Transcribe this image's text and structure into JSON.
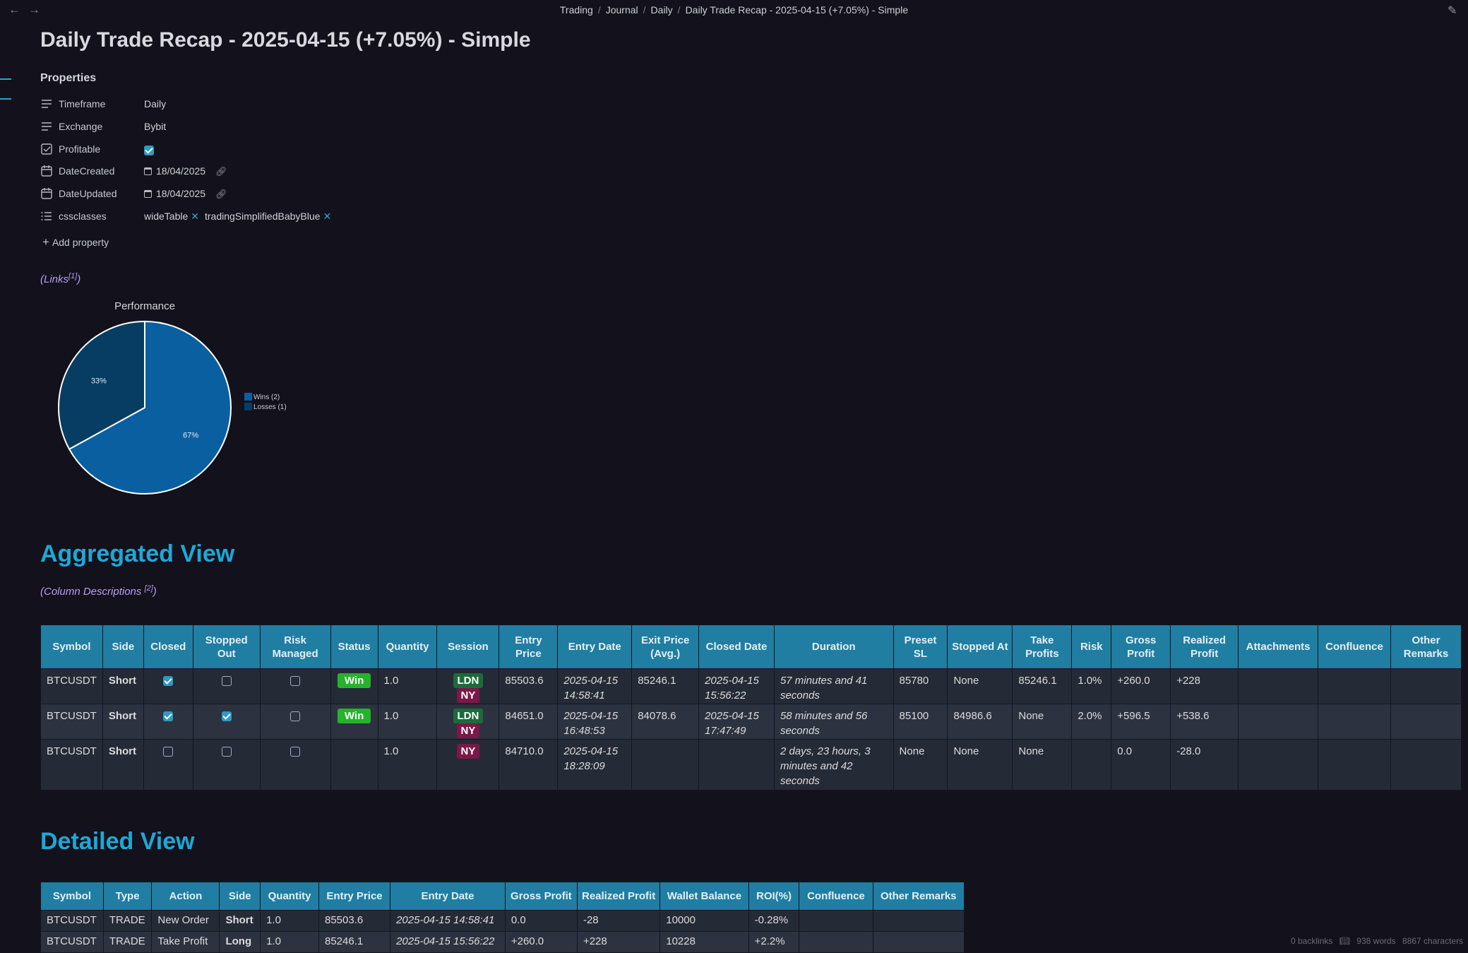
{
  "breadcrumb": [
    "Trading",
    "Journal",
    "Daily",
    "Daily Trade Recap - 2025-04-15 (+7.05%) - Simple"
  ],
  "title": "Daily Trade Recap - 2025-04-15 (+7.05%) - Simple",
  "properties": {
    "heading": "Properties",
    "timeframe": {
      "key": "Timeframe",
      "value": "Daily"
    },
    "exchange": {
      "key": "Exchange",
      "value": "Bybit"
    },
    "profitable": {
      "key": "Profitable",
      "checked": true
    },
    "date_created": {
      "key": "DateCreated",
      "value": "18/04/2025"
    },
    "date_updated": {
      "key": "DateUpdated",
      "value": "18/04/2025"
    },
    "cssclasses": {
      "key": "cssclasses",
      "tags": [
        "wideTable",
        "tradingSimplifiedBabyBlue"
      ]
    },
    "add_label": "Add property"
  },
  "links": {
    "label": "Links",
    "ref": "[1]"
  },
  "chart_data": {
    "type": "pie",
    "title": "Performance",
    "slices": [
      {
        "label": "Wins (2)",
        "value": 67,
        "display": "67%",
        "color": "#0a5fa0"
      },
      {
        "label": "Losses (1)",
        "value": 33,
        "display": "33%",
        "color": "#083d63"
      }
    ]
  },
  "aggregated": {
    "heading": "Aggregated View",
    "col_desc": "Column Descriptions ",
    "col_ref": "[2]",
    "headers": [
      "Symbol",
      "Side",
      "Closed",
      "Stopped Out",
      "Risk Managed",
      "Status",
      "Quantity",
      "Session",
      "Entry Price",
      "Entry Date",
      "Exit Price (Avg.)",
      "Closed Date",
      "Duration",
      "Preset SL",
      "Stopped At",
      "Take Profits",
      "Risk",
      "Gross Profit",
      "Realized Profit",
      "Attachments",
      "Confluence",
      "Other Remarks"
    ],
    "rows": [
      {
        "symbol": "BTCUSDT",
        "side": "Short",
        "closed": true,
        "stopped": false,
        "risk_managed": false,
        "status": "Win",
        "quantity": "1.0",
        "sessions": [
          "LDN",
          "NY"
        ],
        "entry_price": "85503.6",
        "entry_date": "2025-04-15 14:58:41",
        "exit_price": "85246.1",
        "closed_date": "2025-04-15 15:56:22",
        "duration": "57 minutes and 41 seconds",
        "preset_sl": "85780",
        "stopped_at": "None",
        "take_profits": "85246.1",
        "risk": "1.0%",
        "gross": "+260.0",
        "realized": "+228"
      },
      {
        "symbol": "BTCUSDT",
        "side": "Short",
        "closed": true,
        "stopped": true,
        "risk_managed": false,
        "status": "Win",
        "quantity": "1.0",
        "sessions": [
          "LDN",
          "NY"
        ],
        "entry_price": "84651.0",
        "entry_date": "2025-04-15 16:48:53",
        "exit_price": "84078.6",
        "closed_date": "2025-04-15 17:47:49",
        "duration": "58 minutes and 56 seconds",
        "preset_sl": "85100",
        "stopped_at": "84986.6",
        "take_profits": "None",
        "risk": "2.0%",
        "gross": "+596.5",
        "realized": "+538.6"
      },
      {
        "symbol": "BTCUSDT",
        "side": "Short",
        "closed": false,
        "stopped": false,
        "risk_managed": false,
        "status": "",
        "quantity": "1.0",
        "sessions": [
          "NY"
        ],
        "entry_price": "84710.0",
        "entry_date": "2025-04-15 18:28:09",
        "exit_price": "",
        "closed_date": "",
        "duration": "2 days, 23 hours, 3 minutes and 42 seconds",
        "preset_sl": "None",
        "stopped_at": "None",
        "take_profits": "None",
        "risk": "",
        "gross": "0.0",
        "realized": "-28.0"
      }
    ]
  },
  "detailed": {
    "heading": "Detailed View",
    "headers": [
      "Symbol",
      "Type",
      "Action",
      "Side",
      "Quantity",
      "Entry Price",
      "Entry Date",
      "Gross Profit",
      "Realized Profit",
      "Wallet Balance",
      "ROI(%)",
      "Confluence",
      "Other Remarks"
    ],
    "rows": [
      {
        "symbol": "BTCUSDT",
        "type": "TRADE",
        "action": "New Order",
        "side": "Short",
        "quantity": "1.0",
        "entry_price": "85503.6",
        "entry_date": "2025-04-15 14:58:41",
        "gross": "0.0",
        "realized": "-28",
        "wallet": "10000",
        "roi": "-0.28%"
      },
      {
        "symbol": "BTCUSDT",
        "type": "TRADE",
        "action": "Take Profit",
        "side": "Long",
        "quantity": "1.0",
        "entry_price": "85246.1",
        "entry_date": "2025-04-15 15:56:22",
        "gross": "+260.0",
        "realized": "+228",
        "wallet": "10228",
        "roi": "+2.2%"
      }
    ]
  },
  "status_bar": {
    "backlinks": "0 backlinks",
    "words": "938 words",
    "characters": "8867 characters"
  }
}
